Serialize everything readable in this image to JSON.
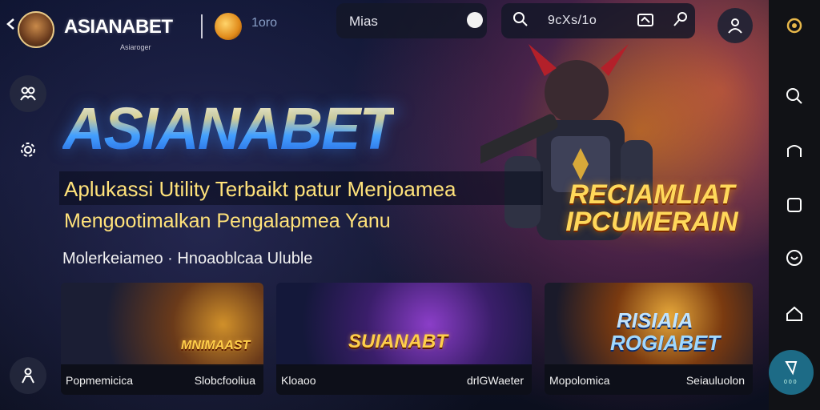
{
  "header": {
    "brand": "ASIANABET",
    "brand_sub": "Asiaroger",
    "coin_value": "1oro",
    "search_text": "Mias",
    "meta_text": "9cXs/1o",
    "icons": [
      "back-icon",
      "avatar",
      "coin-icon",
      "clock-icon",
      "search-icon",
      "message-icon",
      "share-icon",
      "user-icon"
    ]
  },
  "hero": {
    "title": "ASIANABET",
    "tagline_line1": "Aplukassi Utility Terbaikt patur Menjoamea",
    "tagline_line2": "Mengootimalkan Pengalapmea Yanu",
    "subtext": "Molerkeiameo · Hnoaoblcaa Uluble",
    "promo_line1": "RECIAMLIAT",
    "promo_line2": "IPCUMERAIN"
  },
  "cards": [
    {
      "logo": "MNIMAAST",
      "left": "Popmemicica",
      "right": "Slobcfooliua"
    },
    {
      "logo": "SUIANABT",
      "left": "Kloaoo",
      "right": "drlGWaeter"
    },
    {
      "logo_line1": "RISIAIA",
      "logo_line2": "ROGIABET",
      "left": "Mopolomica",
      "right": "Seiauluolon"
    }
  ],
  "rail": {
    "icons": [
      "home-icon",
      "search-icon",
      "profile-icon",
      "square-icon",
      "heart-icon",
      "house-icon"
    ],
    "fab_label": "0 0 0"
  },
  "colors": {
    "accent": "#ffe27a",
    "rail_bg": "#111216",
    "fab": "#1d6b86"
  }
}
